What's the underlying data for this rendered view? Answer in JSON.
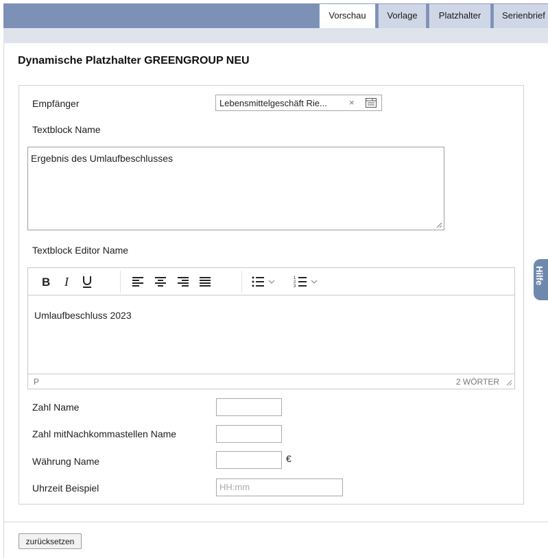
{
  "tabs": [
    {
      "label": "Vorschau",
      "active": true
    },
    {
      "label": "Vorlage",
      "active": false
    },
    {
      "label": "Platzhalter",
      "active": false
    },
    {
      "label": "Serienbrief",
      "active": false
    }
  ],
  "page_title": "Dynamische Platzhalter GREENGROUP NEU",
  "form": {
    "empfaenger_label": "Empfänger",
    "empfaenger_value": "Lebensmittelgeschäft Rie...",
    "clear_glyph": "×",
    "textblock_label": "Textblock Name",
    "textblock_value": "Ergebnis des Umlaufbeschlusses",
    "editor_label": "Textblock Editor Name",
    "editor_content": "Umlaufbeschluss 2023",
    "editor_path": "P",
    "editor_wordcount": "2 WÖRTER",
    "zahl_label": "Zahl Name",
    "zahl_nachkomma_label": "Zahl mitNachkommastellen Name",
    "waehrung_label": "Währung Name",
    "currency_symbol": "€",
    "uhrzeit_label": "Uhrzeit Beispiel",
    "uhrzeit_placeholder": "HH:mm"
  },
  "toolbar_icons": [
    "bold-icon",
    "italic-icon",
    "underline-icon",
    "align-left-icon",
    "align-center-icon",
    "align-right-icon",
    "align-justify-icon",
    "bullet-list-icon",
    "numbered-list-icon"
  ],
  "reset_label": "zurücksetzen",
  "help_tab_label": "Hilfe",
  "colors": {
    "header_band": "#7d90b6",
    "tab_bg": "#cfd6e6",
    "help_tab": "#6f89ad"
  }
}
